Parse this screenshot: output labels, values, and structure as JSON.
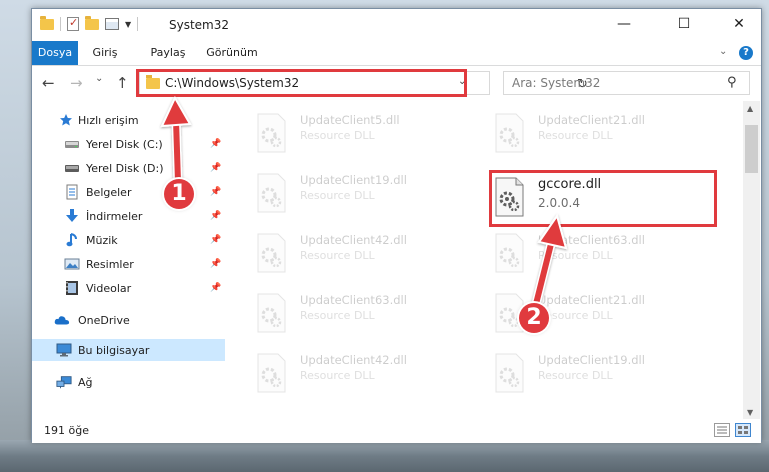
{
  "window": {
    "title": "System32",
    "minimize_glyph": "—",
    "maximize_glyph": "☐",
    "close_glyph": "✕"
  },
  "ribbon": {
    "tabs": [
      "Dosya",
      "Giriş",
      "Paylaş",
      "Görünüm"
    ],
    "help_glyph": "?",
    "collapse_glyph": "⌄"
  },
  "navigation": {
    "back_glyph": "←",
    "forward_glyph": "→",
    "recent_glyph": "⌄",
    "up_glyph": "↑",
    "address": "C:\\Windows\\System32",
    "refresh_glyph": "↻",
    "search_placeholder": "Ara: System32",
    "search_glyph": "⚲"
  },
  "sidebar": {
    "items": [
      {
        "label": "Hızlı erişim",
        "icon": "star-icon",
        "pinned": false
      },
      {
        "label": "Yerel Disk (C:)",
        "icon": "drive-icon",
        "pinned": true
      },
      {
        "label": "Yerel Disk (D:)",
        "icon": "drive-icon",
        "pinned": true
      },
      {
        "label": "Belgeler",
        "icon": "documents-icon",
        "pinned": true
      },
      {
        "label": "İndirmeler",
        "icon": "downloads-icon",
        "pinned": true
      },
      {
        "label": "Müzik",
        "icon": "music-icon",
        "pinned": true
      },
      {
        "label": "Resimler",
        "icon": "pictures-icon",
        "pinned": true
      },
      {
        "label": "Videolar",
        "icon": "videos-icon",
        "pinned": true
      },
      {
        "label": "OneDrive",
        "icon": "cloud-icon",
        "pinned": false
      },
      {
        "label": "Bu bilgisayar",
        "icon": "computer-icon",
        "pinned": false,
        "selected": true
      },
      {
        "label": "Ağ",
        "icon": "network-icon",
        "pinned": false
      }
    ],
    "pin_glyph": "📌"
  },
  "files": {
    "left_column": [
      {
        "name": "UpdateClient5.dll",
        "desc": "Resource DLL"
      },
      {
        "name": "UpdateClient19.dll",
        "desc": "Resource DLL"
      },
      {
        "name": "UpdateClient42.dll",
        "desc": "Resource DLL"
      },
      {
        "name": "UpdateClient63.dll",
        "desc": "Resource DLL"
      },
      {
        "name": "UpdateClient42.dll",
        "desc": "Resource DLL"
      }
    ],
    "right_column": [
      {
        "name": "UpdateClient21.dll",
        "desc": "Resource DLL"
      },
      {
        "name": "UpdateClient63.dll",
        "desc": "Resource DLL"
      },
      {
        "name": "UpdateClient21.dll",
        "desc": "Resource DLL"
      },
      {
        "name": "UpdateClient19.dll",
        "desc": "Resource DLL"
      }
    ],
    "featured": {
      "name": "gccore.dll",
      "version": "2.0.0.4"
    }
  },
  "status": {
    "item_count": "191 öğe"
  },
  "annotations": {
    "step1": "1",
    "step2": "2",
    "accent_color": "#e03a3e"
  }
}
